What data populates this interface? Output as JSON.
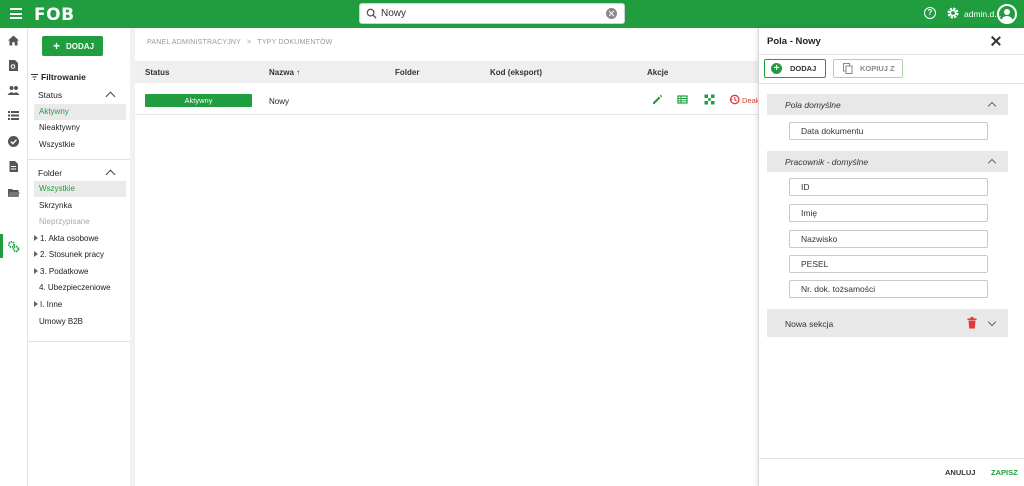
{
  "app": {
    "logo": "FOB",
    "user": "admin.d..."
  },
  "search": {
    "value": "Nowy",
    "placeholder": ""
  },
  "sidebar": {
    "add_label": "DODAJ",
    "filter_title": "Filtrowanie",
    "status_header": "Status",
    "status_items": [
      "Aktywny",
      "Nieaktywny",
      "Wszystkie"
    ],
    "folder_header": "Folder",
    "folder_items": [
      "Wszystkie",
      "Skrzynka",
      "Nieprzypisane",
      "1. Akta osobowe",
      "2. Stosunek pracy",
      "3. Podatkowe",
      "4. Ubezpieczeniowe",
      "I. Inne",
      "Umowy B2B"
    ]
  },
  "breadcrumb": {
    "root": "PANEL ADMINISTRACYJNY",
    "current": "TYPY DOKUMENTÓW"
  },
  "table": {
    "columns": [
      "Status",
      "Nazwa ↑",
      "Folder",
      "Kod (eksport)",
      "Akcje"
    ],
    "row": {
      "status": "Aktywny",
      "name": "Nowy",
      "folder": "",
      "code": "",
      "deactivate": "Deak"
    }
  },
  "panel": {
    "title": "Pola - Nowy",
    "add_label": "DODAJ",
    "copy_label": "KOPIUJ Z",
    "sections": [
      {
        "label": "Pola domyślne",
        "fields": [
          "Data dokumentu"
        ]
      },
      {
        "label": "Pracownik - domyślne",
        "fields": [
          "ID",
          "Imię",
          "Nazwisko",
          "PESEL",
          "Nr. dok. tożsamości"
        ]
      },
      {
        "label": "Nowa sekcja",
        "fields": []
      }
    ],
    "cancel_label": "ANULUJ",
    "save_label": "ZAPISZ"
  },
  "colors": {
    "brand": "#1f9d3f",
    "danger": "#e53935"
  }
}
